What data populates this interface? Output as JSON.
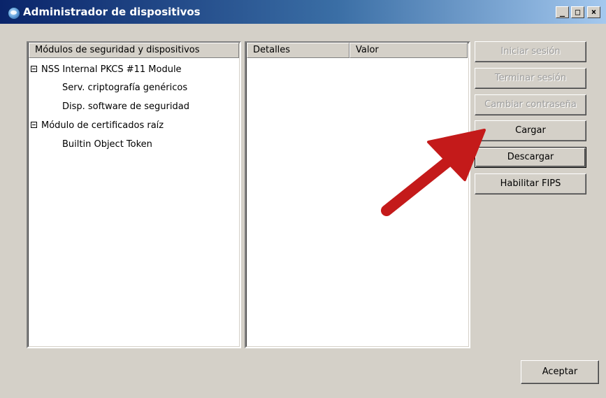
{
  "window": {
    "title": "Administrador de dispositivos",
    "controls": [
      "minimize",
      "maximize",
      "close"
    ]
  },
  "modules_panel": {
    "header": "Módulos de seguridad y dispositivos",
    "tree": [
      {
        "label": "NSS Internal PKCS #11 Module",
        "expanded": true,
        "children": [
          "Serv. criptografía genéricos",
          "Disp. software de seguridad"
        ]
      },
      {
        "label": "Módulo de certificados raíz",
        "expanded": true,
        "children": [
          "Builtin Object Token"
        ]
      }
    ]
  },
  "details_panel": {
    "columns": [
      "Detalles",
      "Valor"
    ],
    "rows": []
  },
  "buttons": {
    "login": {
      "label": "Iniciar sesión",
      "enabled": false
    },
    "logout": {
      "label": "Terminar sesión",
      "enabled": false
    },
    "change_password": {
      "label": "Cambiar contraseña",
      "enabled": false
    },
    "load": {
      "label": "Cargar",
      "enabled": true
    },
    "unload": {
      "label": "Descargar",
      "enabled": true
    },
    "enable_fips": {
      "label": "Habilitar FIPS",
      "enabled": true
    },
    "ok": {
      "label": "Aceptar",
      "enabled": true
    }
  },
  "annotation": {
    "type": "arrow",
    "color": "#c41a1a",
    "points_to": "Cargar"
  },
  "colors": {
    "titlebar_start": "#0a246a",
    "titlebar_end": "#a6caf0",
    "window_face": "#d4d0c8",
    "disabled_text": "#9b9b9b"
  }
}
